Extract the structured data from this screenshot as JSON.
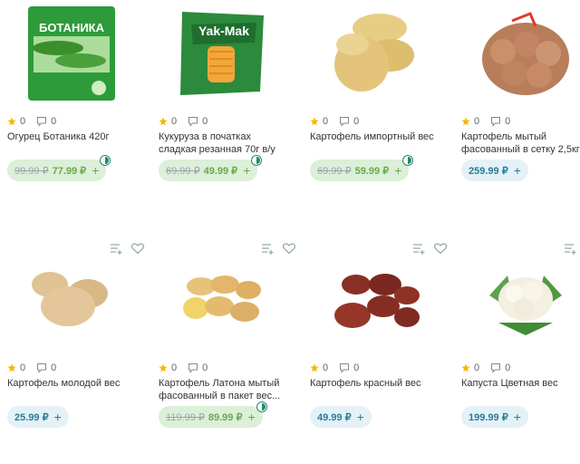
{
  "products": [
    {
      "title": "Огурец Ботаника 420г",
      "rating": "0",
      "reviews": "0",
      "old_price": "99.99 ₽",
      "price": "77.99 ₽",
      "plus": "+",
      "package_text": "БОТАНИКА"
    },
    {
      "title": "Кукуруза в початках сладкая резанная 70г в/у",
      "rating": "0",
      "reviews": "0",
      "old_price": "69.99 ₽",
      "price": "49.99 ₽",
      "plus": "+",
      "package_text": "Yak-Mak"
    },
    {
      "title": "Картофель импортный вес",
      "rating": "0",
      "reviews": "0",
      "old_price": "69.99 ₽",
      "price": "59.99 ₽",
      "plus": "+"
    },
    {
      "title": "Картофель мытый фасованный в сетку 2,5кг",
      "rating": "0",
      "reviews": "0",
      "price": "259.99 ₽",
      "plus": "+"
    },
    {
      "title": "Картофель молодой вес",
      "rating": "0",
      "reviews": "0",
      "price": "25.99 ₽",
      "plus": "+"
    },
    {
      "title": "Картофель Латона мытый фасованный в пакет вес...",
      "rating": "0",
      "reviews": "0",
      "old_price": "119.99 ₽",
      "price": "89.99 ₽",
      "plus": "+"
    },
    {
      "title": "Картофель красный вес",
      "rating": "0",
      "reviews": "0",
      "price": "49.99 ₽",
      "plus": "+"
    },
    {
      "title": "Капуста Цветная вес",
      "rating": "0",
      "reviews": "0",
      "price": "199.99 ₽",
      "plus": "+"
    }
  ],
  "colors": {
    "accent_green": "#6aa84f",
    "accent_blue": "#2b7a98",
    "star": "#f5b800"
  },
  "icons": {
    "star": "star-icon",
    "comment": "comment-icon",
    "compare": "compare-list-icon",
    "favorite": "heart-icon",
    "promo": "promo-badge-icon"
  }
}
